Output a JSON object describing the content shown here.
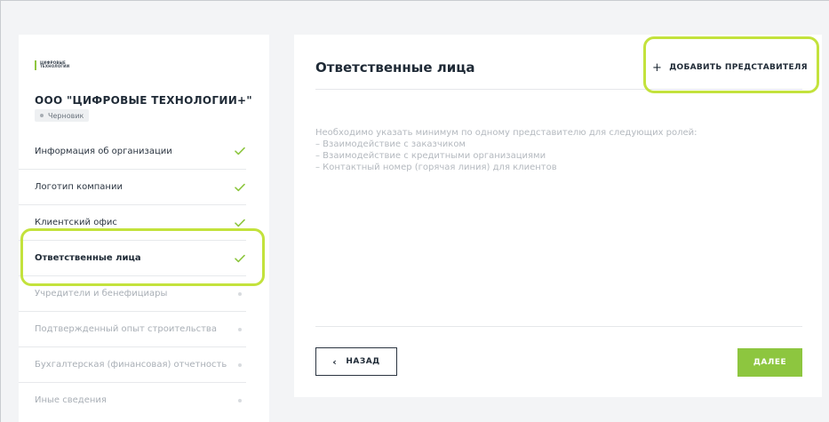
{
  "logo": {
    "text": "ЦИФРОВЫЕ\nТЕХНОЛОГИИ"
  },
  "organization": {
    "name": "ООО \"ЦИФРОВЫЕ ТЕХНОЛОГИИ+\"",
    "status": "Черновик"
  },
  "nav": {
    "items": [
      {
        "label": "Информация об организации",
        "state": "done"
      },
      {
        "label": "Логотип компании",
        "state": "done"
      },
      {
        "label": "Клиентский офис",
        "state": "done"
      },
      {
        "label": "Ответственные лица",
        "state": "active"
      },
      {
        "label": "Учредители и бенефициары",
        "state": "pending"
      },
      {
        "label": "Подтвержденный опыт строительства",
        "state": "pending"
      },
      {
        "label": "Бухгалтерская (финансовая) отчетность",
        "state": "pending"
      },
      {
        "label": "Иные сведения",
        "state": "pending"
      }
    ]
  },
  "main": {
    "title": "Ответственные лица",
    "add_label": "ДОБАВИТЬ ПРЕДСТАВИТЕЛЯ",
    "info_lines": [
      "Необходимо указать минимум по одному представителю для следующих ролей:",
      "– Взаимодействие с заказчиком",
      "– Взаимодействие с кредитными организациями",
      "– Контактный номер (горячая линия) для клиентов"
    ],
    "back_label": "НАЗАД",
    "next_label": "ДАЛЕЕ"
  },
  "colors": {
    "accent": "#8dc63f",
    "highlight": "#c3e23c",
    "text_dark": "#1f2a36",
    "text_muted": "#b4b9bf"
  }
}
